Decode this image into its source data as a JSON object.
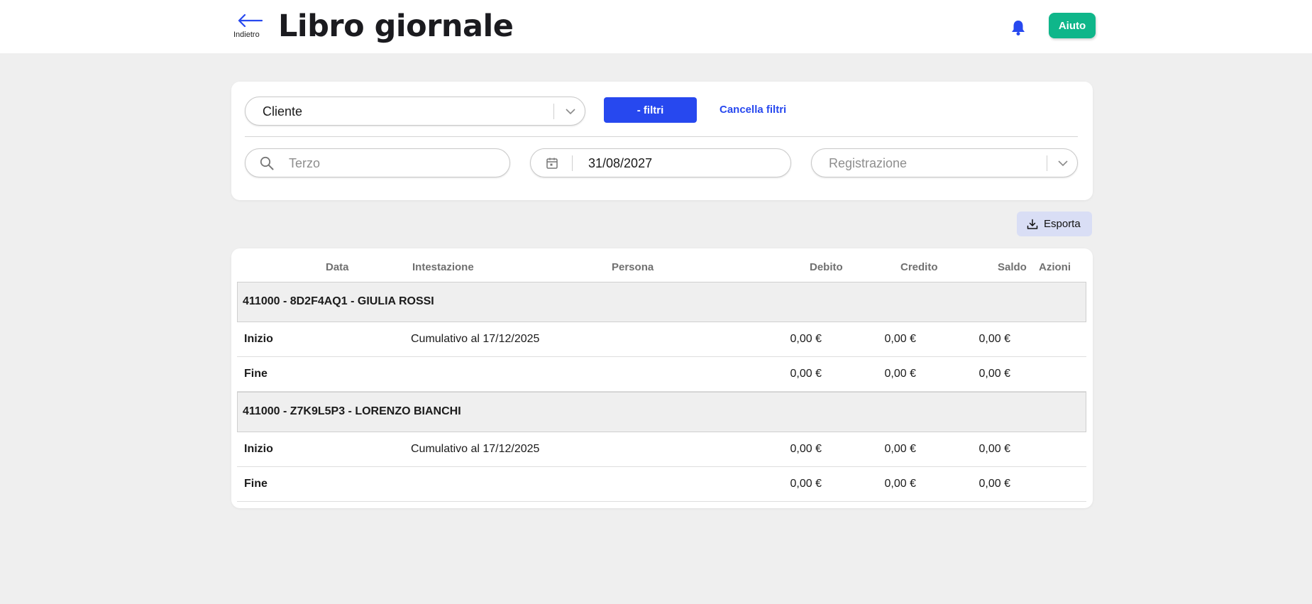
{
  "header": {
    "back_label": "Indietro",
    "title": "Libro giornale",
    "help_label": "Aiuto"
  },
  "filters": {
    "type_select_value": "Cliente",
    "toggle_filters_label": "- filtri",
    "clear_filters_label": "Cancella filtri",
    "third_party_placeholder": "Terzo",
    "date_value": "31/08/2027",
    "registration_placeholder": "Registrazione"
  },
  "toolbar": {
    "export_label": "Esporta"
  },
  "table": {
    "columns": {
      "data": "Data",
      "intestazione": "Intestazione",
      "persona": "Persona",
      "debito": "Debito",
      "credito": "Credito",
      "saldo": "Saldo",
      "azioni": "Azioni"
    },
    "groups": [
      {
        "title": "411000 - 8D2F4AQ1 - GIULIA ROSSI",
        "rows": [
          {
            "label": "Inizio",
            "intestazione": "Cumulativo al 17/12/2025",
            "debito": "0,00 €",
            "credito": "0,00 €",
            "saldo": "0,00 €"
          },
          {
            "label": "Fine",
            "intestazione": "",
            "debito": "0,00 €",
            "credito": "0,00 €",
            "saldo": "0,00 €"
          }
        ]
      },
      {
        "title": "411000 - Z7K9L5P3 - LORENZO BIANCHI",
        "rows": [
          {
            "label": "Inizio",
            "intestazione": "Cumulativo al 17/12/2025",
            "debito": "0,00 €",
            "credito": "0,00 €",
            "saldo": "0,00 €"
          },
          {
            "label": "Fine",
            "intestazione": "",
            "debito": "0,00 €",
            "credito": "0,00 €",
            "saldo": "0,00 €"
          }
        ]
      }
    ]
  },
  "colors": {
    "primary": "#2748ef",
    "help": "#0fb68a",
    "background": "#efefef"
  }
}
